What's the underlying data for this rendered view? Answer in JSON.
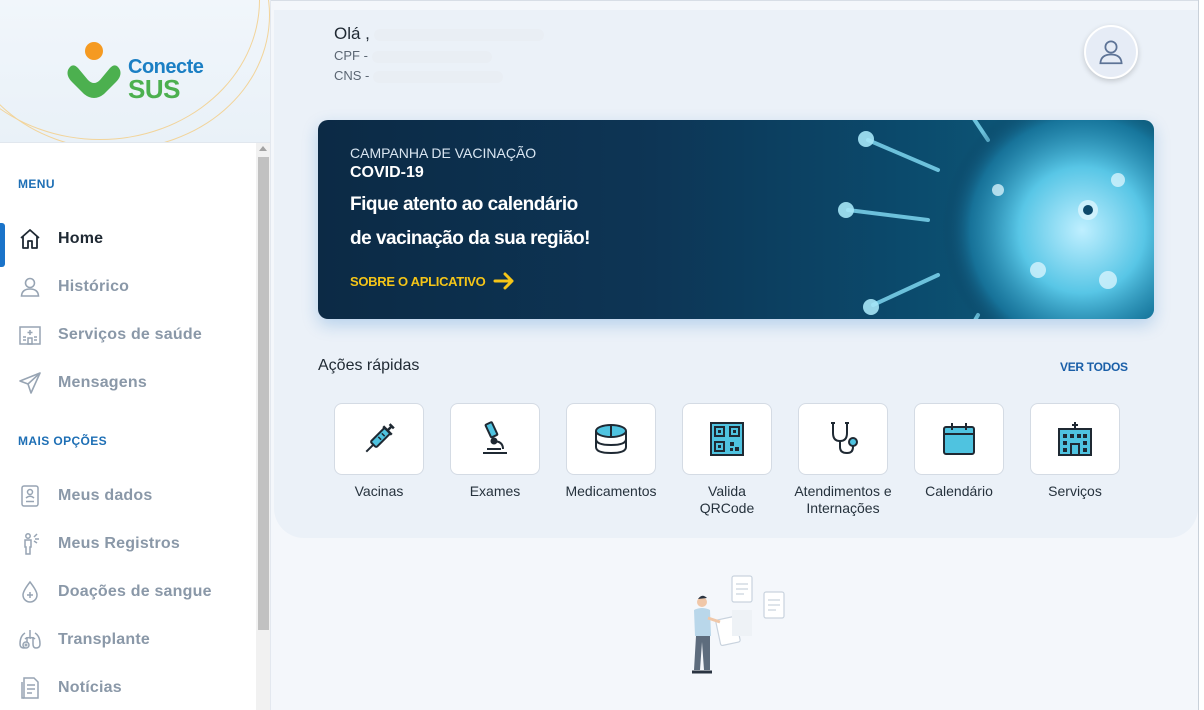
{
  "logo": {
    "line1": "Conecte",
    "line2": "SUS",
    "colors": {
      "blue": "#1b7fc4",
      "green": "#4cb04f",
      "orange": "#f59a21"
    }
  },
  "sidebar": {
    "menu_title": "MENU",
    "menu_items": [
      {
        "label": "Home",
        "icon": "home-icon",
        "active": true
      },
      {
        "label": "Histórico",
        "icon": "user-icon"
      },
      {
        "label": "Serviços de saúde",
        "icon": "hospital-icon"
      },
      {
        "label": "Mensagens",
        "icon": "send-icon"
      }
    ],
    "more_title": "MAIS OPÇÕES",
    "more_items": [
      {
        "label": "Meus dados",
        "icon": "id-card-icon"
      },
      {
        "label": "Meus Registros",
        "icon": "person-records-icon"
      },
      {
        "label": "Doações de sangue",
        "icon": "blood-drop-icon"
      },
      {
        "label": "Transplante",
        "icon": "lungs-icon"
      },
      {
        "label": "Notícias",
        "icon": "news-icon"
      }
    ]
  },
  "header": {
    "greeting": "Olá ,",
    "cpf_label": "CPF -",
    "cns_label": "CNS -"
  },
  "banner": {
    "kicker": "CAMPANHA DE VACINAÇÃO",
    "kicker2": "COVID-19",
    "headline_line1": "Fique atento ao calendário",
    "headline_line2": "de vacinação da sua região!",
    "cta": "SOBRE O APLICATIVO"
  },
  "quick_actions": {
    "title": "Ações rápidas",
    "see_all": "VER TODOS",
    "items": [
      {
        "label": "Vacinas",
        "icon": "syringe-icon"
      },
      {
        "label": "Exames",
        "icon": "microscope-icon"
      },
      {
        "label": "Medicamentos",
        "icon": "pill-icon"
      },
      {
        "label": "Valida QRCode",
        "icon": "qrcode-icon"
      },
      {
        "label": "Atendimentos e Internações",
        "icon": "stethoscope-icon"
      },
      {
        "label": "Calendário",
        "icon": "calendar-icon"
      },
      {
        "label": "Serviços",
        "icon": "building-icon"
      }
    ]
  },
  "colors": {
    "accent": "#1a73c9",
    "cta_yellow": "#f5c518",
    "icon_teal": "#4fc3e0"
  }
}
